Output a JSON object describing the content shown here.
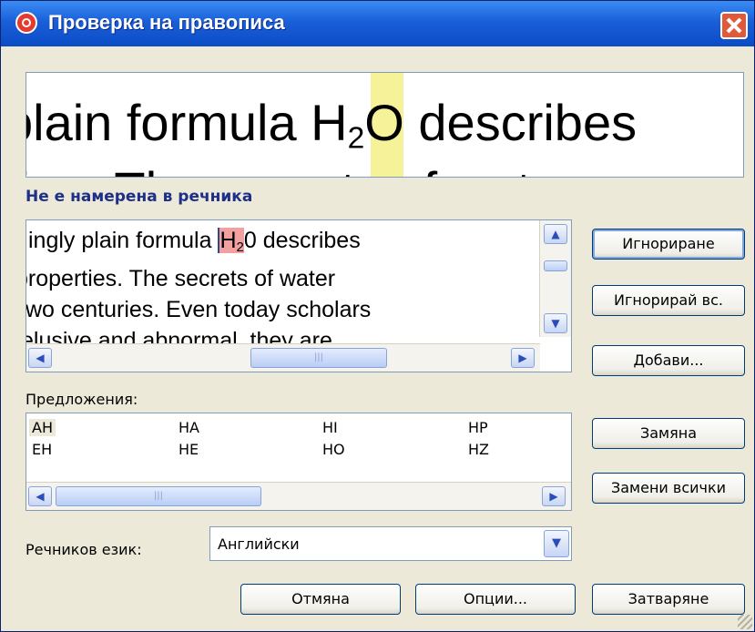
{
  "window": {
    "title": "Проверка на правописа"
  },
  "preview": {
    "line1_before": "plain formula H",
    "line1_sub": "2",
    "line1_after": "O describes",
    "line2": "tion. The secrets of water"
  },
  "not_found_label": "Не е намерена в речника",
  "context": {
    "line1_before": "ingly plain formula ",
    "line1_err": "H",
    "line1_sub": "2",
    "line1_after": "0 describes",
    "line2": "properties. The secrets of water",
    "line3": "two centuries. Even today scholars",
    "line4": "elusive and abnormal, they are"
  },
  "buttons": {
    "ignore": "Игнориране",
    "ignore_all": "Игнорирай вс.",
    "add": "Добави...",
    "change": "Замяна",
    "change_all": "Замени всички",
    "cancel": "Отмяна",
    "options": "Опции...",
    "close": "Затваряне"
  },
  "suggestions": {
    "label": "Предложения:",
    "items": [
      "AH",
      "HA",
      "HI",
      "HP",
      "EH",
      "HE",
      "HO",
      "HZ"
    ],
    "selected": "AH"
  },
  "language": {
    "label": "Речников език:",
    "value": "Английски"
  },
  "icons": {
    "app": "spellcheck-app-icon",
    "close": "close-icon"
  },
  "colors": {
    "titlebar": "#0b4cc5",
    "highlight": "#f6f29a",
    "error": "#f2a0a0",
    "label": "#1e2f8a"
  }
}
